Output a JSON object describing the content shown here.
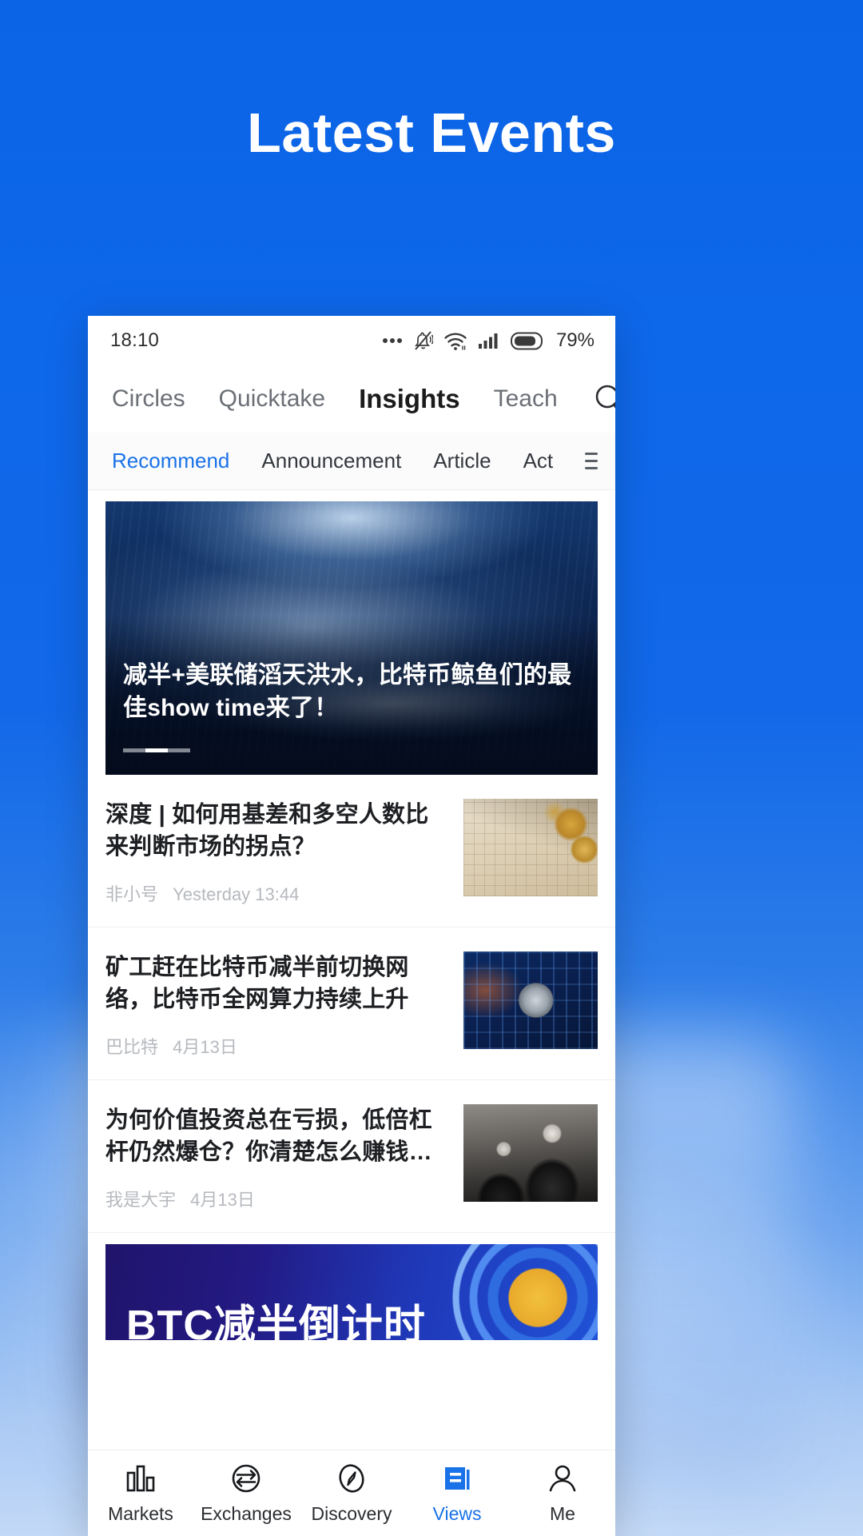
{
  "promo": {
    "title": "Latest Events",
    "background_color": "#0e68ea"
  },
  "phone": {
    "status_bar": {
      "time": "18:10",
      "battery_percent": "79%",
      "icons": [
        "more-dots-icon",
        "bell-muted-icon",
        "wifi-icon",
        "cellular-signal-icon",
        "battery-icon"
      ]
    },
    "top_nav": {
      "items": [
        {
          "label": "Circles",
          "active": false
        },
        {
          "label": "Quicktake",
          "active": false
        },
        {
          "label": "Insights",
          "active": true
        },
        {
          "label": "Teach",
          "active": false
        }
      ],
      "search_icon": "search-icon"
    },
    "sub_tabs": {
      "items": [
        {
          "label": "Recommend",
          "active": true
        },
        {
          "label": "Announcement",
          "active": false
        },
        {
          "label": "Article",
          "active": false
        },
        {
          "label": "Act",
          "active": false
        }
      ],
      "more_icon": "hamburger-menu-icon",
      "active_color": "#1972e8"
    },
    "hero": {
      "title": "减半+美联储滔天洪水，比特币鲸鱼们的最佳show time来了！",
      "image_alt": "underwater-whale-photo",
      "carousel_total": 3,
      "carousel_active_index": 2
    },
    "articles": [
      {
        "title": "深度 | 如何用基差和多空人数比来判断市场的拐点？",
        "source": "非小号",
        "date": "Yesterday 13:44",
        "thumb": "gold-coins-on-grid-paper"
      },
      {
        "title": "矿工赶在比特币减半前切换网络，比特币全网算力持续上升",
        "source": "巴比特",
        "date": "4月13日",
        "thumb": "bitcoin-coin-on-circuit-board"
      },
      {
        "title": "为何价值投资总在亏损，低倍杠杆仍然爆仓？你清楚怎么赚钱…",
        "source": "我是大宇",
        "date": "4月13日",
        "thumb": "vintage-black-white-portrait"
      }
    ],
    "bottom_banner": {
      "text": "BTC减半倒计时"
    },
    "tab_bar": {
      "items": [
        {
          "label": "Markets",
          "icon": "bar-chart-icon",
          "active": false
        },
        {
          "label": "Exchanges",
          "icon": "exchange-arrows-icon",
          "active": false
        },
        {
          "label": "Discovery",
          "icon": "compass-icon",
          "active": false
        },
        {
          "label": "Views",
          "icon": "document-lines-icon",
          "active": true
        },
        {
          "label": "Me",
          "icon": "person-icon",
          "active": false
        }
      ],
      "active_color": "#1972e8"
    }
  }
}
